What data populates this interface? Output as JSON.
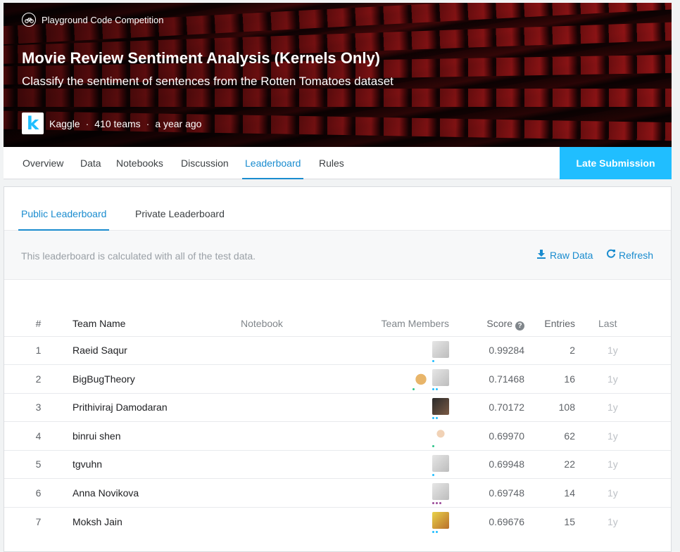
{
  "hero": {
    "competition_type": "Playground Code Competition",
    "title": "Movie Review Sentiment Analysis (Kernels Only)",
    "subtitle": "Classify the sentiment of sentences from the Rotten Tomatoes dataset",
    "host_logo_letter": "k",
    "host": "Kaggle",
    "separator": "·",
    "teams": "410 teams",
    "time": "a year ago"
  },
  "tabs": [
    {
      "label": "Overview"
    },
    {
      "label": "Data"
    },
    {
      "label": "Notebooks"
    },
    {
      "label": "Discussion"
    },
    {
      "label": "Leaderboard",
      "active": true
    },
    {
      "label": "Rules"
    }
  ],
  "late_submission_label": "Late Submission",
  "leaderboard": {
    "subtabs": [
      {
        "label": "Public Leaderboard",
        "active": true
      },
      {
        "label": "Private Leaderboard"
      }
    ],
    "info_text": "This leaderboard is calculated with all of the test data.",
    "raw_data_label": "Raw Data",
    "refresh_label": "Refresh",
    "columns": {
      "rank": "#",
      "team": "Team Name",
      "notebook": "Notebook",
      "members": "Team Members",
      "score": "Score",
      "entries": "Entries",
      "last": "Last"
    },
    "rows": [
      {
        "rank": "1",
        "team": "Raeid Saqur",
        "score": "0.99284",
        "entries": "2",
        "last": "1y"
      },
      {
        "rank": "2",
        "team": "BigBugTheory",
        "score": "0.71468",
        "entries": "16",
        "last": "1y"
      },
      {
        "rank": "3",
        "team": "Prithiviraj Damodaran",
        "score": "0.70172",
        "entries": "108",
        "last": "1y"
      },
      {
        "rank": "4",
        "team": "binrui shen",
        "score": "0.69970",
        "entries": "62",
        "last": "1y"
      },
      {
        "rank": "5",
        "team": "tgvuhn",
        "score": "0.69948",
        "entries": "22",
        "last": "1y"
      },
      {
        "rank": "6",
        "team": "Anna Novikova",
        "score": "0.69748",
        "entries": "14",
        "last": "1y"
      },
      {
        "rank": "7",
        "team": "Moksh Jain",
        "score": "0.69676",
        "entries": "15",
        "last": "1y"
      }
    ]
  },
  "colors": {
    "accent": "#1a8ccf",
    "late_submission_bg": "#20beff",
    "muted_text": "#9aa0a6"
  }
}
